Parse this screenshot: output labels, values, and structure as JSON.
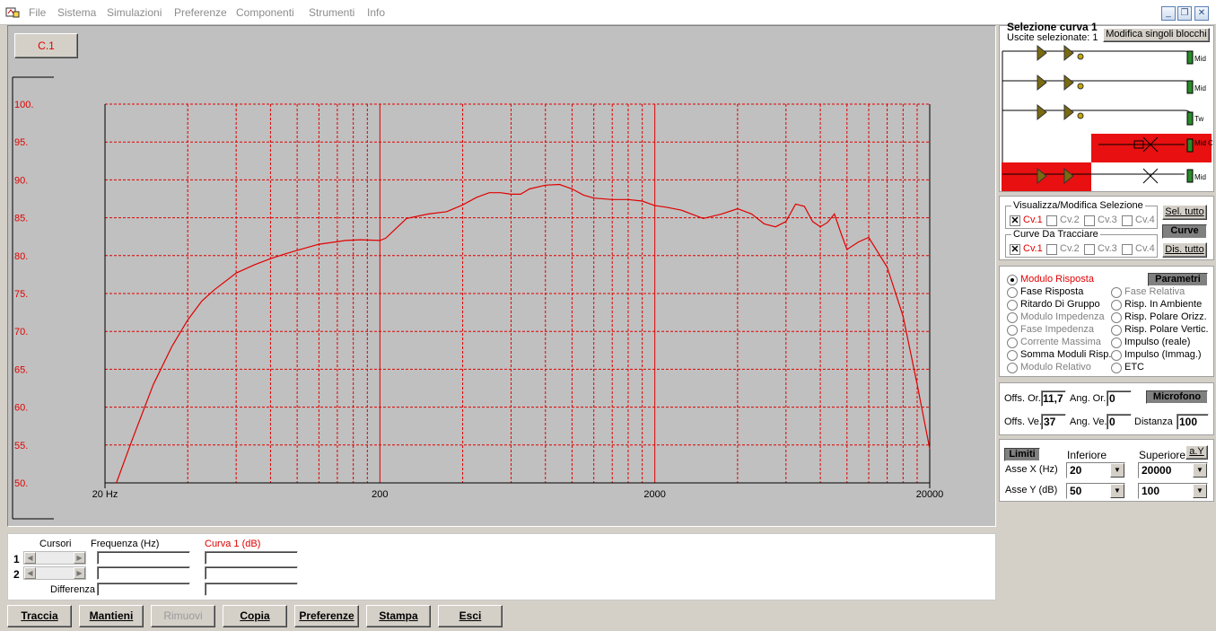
{
  "menu": {
    "items": [
      "File",
      "Sistema",
      "Simulazioni",
      "Preferenze",
      "Componenti",
      "Strumenti",
      "Info"
    ]
  },
  "window_controls": {
    "minimize": "_",
    "restore": "❐",
    "close": "✕"
  },
  "plot": {
    "curve_button": "C.1",
    "y_ticks": [
      "100.",
      "95.",
      "90.",
      "85.",
      "80.",
      "75.",
      "70.",
      "65.",
      "60.",
      "55.",
      "50."
    ],
    "x_ticks": [
      "20 Hz",
      "200",
      "2000",
      "20000"
    ]
  },
  "chart_data": {
    "type": "line",
    "title": "",
    "xlabel": "",
    "ylabel": "",
    "x_scale": "log",
    "xlim": [
      20,
      20000
    ],
    "ylim": [
      50,
      100
    ],
    "grid": true,
    "series": [
      {
        "name": "",
        "color": "#e00000",
        "x": [
          22,
          25,
          30,
          35,
          40,
          45,
          50,
          60,
          70,
          80,
          90,
          100,
          120,
          150,
          170,
          200,
          210,
          250,
          300,
          350,
          400,
          450,
          500,
          550,
          600,
          650,
          700,
          800,
          900,
          1000,
          1100,
          1200,
          1400,
          1600,
          1800,
          2000,
          2200,
          2500,
          3000,
          3500,
          4000,
          4500,
          5000,
          5500,
          6000,
          6500,
          7000,
          7500,
          8000,
          8500,
          9000,
          9500,
          10000,
          11000,
          12000,
          14000,
          16000,
          18000,
          20000
        ],
        "y": [
          50,
          55.5,
          63,
          68,
          71.5,
          74,
          75.5,
          77.7,
          78.8,
          79.6,
          80.2,
          80.7,
          81.5,
          82,
          82.1,
          82,
          82.3,
          84.9,
          85.5,
          85.8,
          86.7,
          87.7,
          88.3,
          88.3,
          88.1,
          88.1,
          88.8,
          89.3,
          89.4,
          88.8,
          88,
          87.6,
          87.4,
          87.4,
          87.2,
          86.6,
          86.4,
          86,
          84.9,
          85.5,
          86.2,
          85.5,
          84.2,
          83.8,
          84.5,
          86.8,
          86.5,
          84.5,
          83.8,
          84.4,
          85.5,
          83,
          80.8,
          81.8,
          82.4,
          78.5,
          72,
          63,
          54.5
        ]
      }
    ]
  },
  "bottom": {
    "cursori_label": "Cursori",
    "freq_label": "Frequenza (Hz)",
    "curve_label": "Curva 1 (dB)",
    "row1": "1",
    "row2": "2",
    "diff_label": "Differenza"
  },
  "toolbar": {
    "traccia": "Traccia",
    "mantieni": "Mantieni",
    "rimuovi": "Rimuovi",
    "copia": "Copia",
    "preferenze": "Preferenze",
    "stampa": "Stampa",
    "esci": "Esci"
  },
  "selection": {
    "title": "Selezione curva 1",
    "subtitle": "Uscite selezionate: 1",
    "edit_button": "Modifica singoli blocchi",
    "outputs": [
      "Mid",
      "Mid",
      "Tw",
      "Mid Cv.1",
      "Mid"
    ]
  },
  "curves": {
    "vis_title": "Visualizza/Modifica Selezione",
    "draw_title": "Curve Da Tracciare",
    "cv": [
      "Cv.1",
      "Cv.2",
      "Cv.3",
      "Cv.4"
    ],
    "sel_all": "Sel. tutto",
    "header": "Curve",
    "desel_all": "Dis. tutto"
  },
  "params": {
    "header": "Parametri",
    "left": [
      "Modulo Risposta",
      "Fase Risposta",
      "Ritardo Di Gruppo",
      "Modulo Impedenza",
      "Fase Impedenza",
      "Corrente Massima",
      "Somma Moduli Risp.",
      "Modulo Relativo"
    ],
    "right": [
      "Fase Relativa",
      "Risp. In Ambiente",
      "Risp. Polare Orizz.",
      "Risp. Polare Vertic.",
      "Impulso (reale)",
      "Impulso (Immag.)",
      "ETC"
    ]
  },
  "mic": {
    "header": "Microfono",
    "offs_or_label": "Offs. Or.",
    "offs_or": "11,7",
    "ang_or_label": "Ang. Or.",
    "ang_or": "0",
    "offs_ve_label": "Offs. Ve.",
    "offs_ve": "37",
    "ang_ve_label": "Ang. Ve.",
    "ang_ve": "0",
    "dist_label": "Distanza",
    "dist": "100"
  },
  "limits": {
    "header": "Limiti",
    "inf_label": "Inferiore",
    "sup_label": "Superiore",
    "ay_button": "a.Y",
    "x_label": "Asse X  (Hz)",
    "y_label": "Asse Y  (dB)",
    "x_inf": "20",
    "x_sup": "20000",
    "y_inf": "50",
    "y_sup": "100"
  }
}
